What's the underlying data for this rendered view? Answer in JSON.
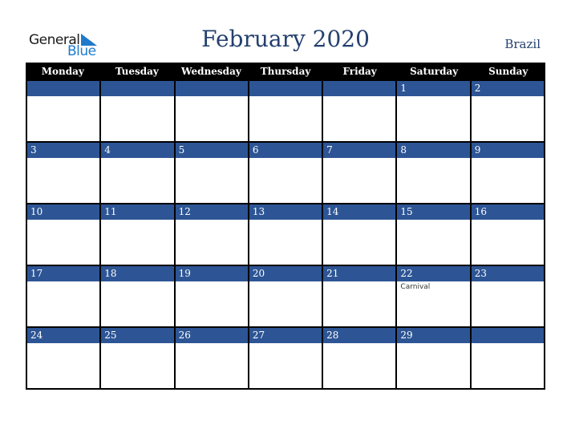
{
  "logo": {
    "line1": "General",
    "line2": "Blue"
  },
  "title": "February 2020",
  "country": "Brazil",
  "weekdays": [
    "Monday",
    "Tuesday",
    "Wednesday",
    "Thursday",
    "Friday",
    "Saturday",
    "Sunday"
  ],
  "weeks": [
    [
      {
        "d": ""
      },
      {
        "d": ""
      },
      {
        "d": ""
      },
      {
        "d": ""
      },
      {
        "d": ""
      },
      {
        "d": "1"
      },
      {
        "d": "2"
      }
    ],
    [
      {
        "d": "3"
      },
      {
        "d": "4"
      },
      {
        "d": "5"
      },
      {
        "d": "6"
      },
      {
        "d": "7"
      },
      {
        "d": "8"
      },
      {
        "d": "9"
      }
    ],
    [
      {
        "d": "10"
      },
      {
        "d": "11"
      },
      {
        "d": "12"
      },
      {
        "d": "13"
      },
      {
        "d": "14"
      },
      {
        "d": "15"
      },
      {
        "d": "16"
      }
    ],
    [
      {
        "d": "17"
      },
      {
        "d": "18"
      },
      {
        "d": "19"
      },
      {
        "d": "20"
      },
      {
        "d": "21"
      },
      {
        "d": "22",
        "e": "Carnival"
      },
      {
        "d": "23"
      }
    ],
    [
      {
        "d": "24"
      },
      {
        "d": "25"
      },
      {
        "d": "26"
      },
      {
        "d": "27"
      },
      {
        "d": "28"
      },
      {
        "d": "29"
      },
      {
        "d": ""
      }
    ]
  ],
  "colors": {
    "band": "#2d5595",
    "title": "#24406e",
    "header": "#000000"
  }
}
